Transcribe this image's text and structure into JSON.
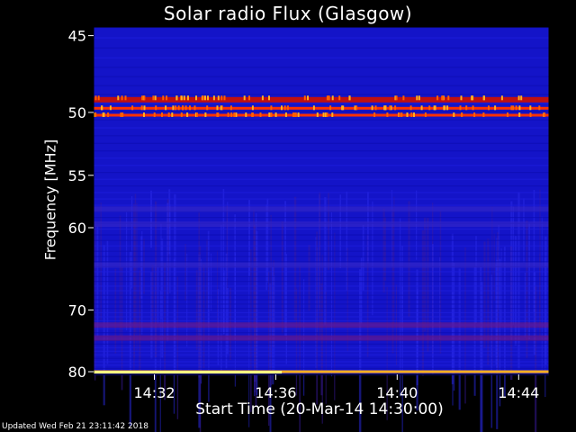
{
  "chart_data": {
    "type": "heatmap",
    "title": "Solar radio Flux (Glasgow)",
    "ylabel": "Frequency [MHz]",
    "xlabel": "Start Time (20-Mar-14 14:30:00)",
    "yticks": [
      45,
      50,
      55,
      60,
      70,
      80
    ],
    "xticks": [
      "14:32",
      "14:36",
      "14:40",
      "14:44"
    ],
    "xtick_minutes": [
      2,
      6,
      10,
      14
    ],
    "x_range_minutes": [
      0,
      15
    ],
    "y_range_mhz": [
      44.5,
      80.5
    ],
    "y_scale": "reciprocal",
    "colormap": [
      "#1010c8",
      "#2a2ae8",
      "#b01010",
      "#ff4000",
      "#ffb020",
      "#ffff80"
    ],
    "bands": [
      {
        "mhz": 49,
        "intensity": 0.7
      },
      {
        "mhz": 49.7,
        "intensity": 0.85
      },
      {
        "mhz": 50.2,
        "intensity": 0.9
      },
      {
        "mhz": 58,
        "intensity": 0.25
      },
      {
        "mhz": 59.5,
        "intensity": 0.3
      },
      {
        "mhz": 64,
        "intensity": 0.35
      },
      {
        "mhz": 72,
        "intensity": 0.45
      },
      {
        "mhz": 74,
        "intensity": 0.5
      },
      {
        "mhz": 80,
        "intensity": 1.0
      }
    ],
    "grid": false
  },
  "footer": "Updated Wed Feb 21 23:11:42 2018"
}
